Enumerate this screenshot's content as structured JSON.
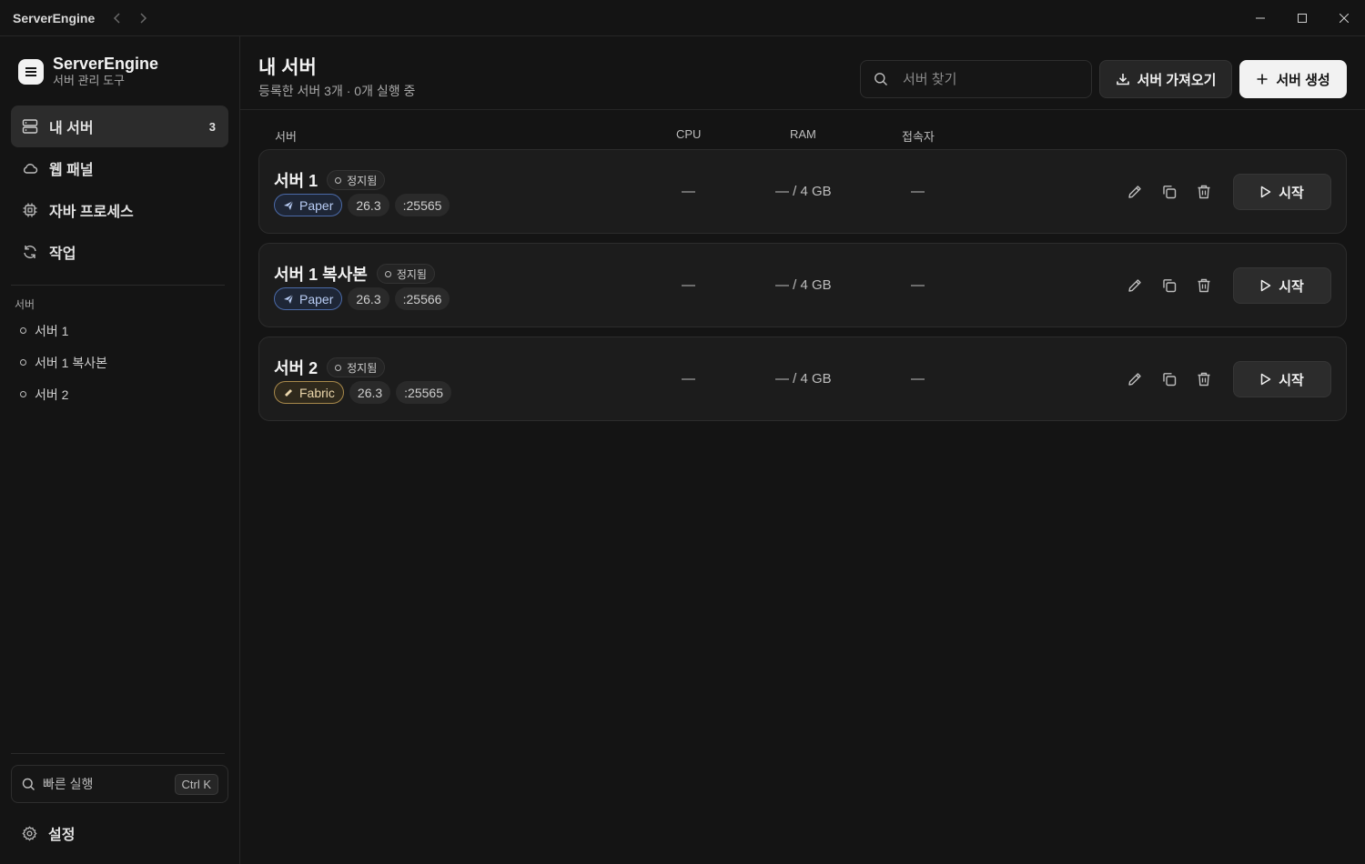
{
  "titlebar": {
    "app_name": "ServerEngine",
    "back_icon": "chevron-left-icon",
    "forward_icon": "chevron-right-icon",
    "window_controls": [
      "minimize-icon",
      "maximize-icon",
      "close-icon"
    ]
  },
  "sidebar": {
    "brand": {
      "title": "ServerEngine",
      "subtitle": "서버 관리 도구",
      "icon": "menu-icon"
    },
    "nav": [
      {
        "label": "내 서버",
        "badge": "3",
        "icon": "server-icon",
        "active": true
      },
      {
        "label": "웹 패널",
        "badge": "",
        "icon": "cloud-icon",
        "active": false
      },
      {
        "label": "자바 프로세스",
        "badge": "",
        "icon": "cpu-icon",
        "active": false
      },
      {
        "label": "작업",
        "badge": "",
        "icon": "refresh-icon",
        "active": false
      }
    ],
    "section_label": "서버",
    "servers": [
      "서버 1",
      "서버 1 복사본",
      "서버 2"
    ],
    "quick_run": {
      "label": "빠른 실행",
      "shortcut": "Ctrl K"
    },
    "settings_label": "설정"
  },
  "main": {
    "title": "내 서버",
    "subtitle": "등록한 서버 3개 · 0개 실행 중",
    "search_placeholder": "서버 찾기",
    "import_label": "서버 가져오기",
    "create_label": "서버 생성",
    "columns": {
      "server": "서버",
      "cpu": "CPU",
      "ram": "RAM",
      "players": "접속자"
    },
    "cards": [
      {
        "name": "서버 1",
        "status": "정지됨",
        "software": "Paper",
        "software_type": "paper",
        "version": "26.3",
        "port": ":25565",
        "cpu": "—",
        "ram": "— / 4 GB",
        "players": "—",
        "start_label": "시작"
      },
      {
        "name": "서버 1 복사본",
        "status": "정지됨",
        "software": "Paper",
        "software_type": "paper",
        "version": "26.3",
        "port": ":25566",
        "cpu": "—",
        "ram": "— / 4 GB",
        "players": "—",
        "start_label": "시작"
      },
      {
        "name": "서버 2",
        "status": "정지됨",
        "software": "Fabric",
        "software_type": "fabric",
        "version": "26.3",
        "port": ":25565",
        "cpu": "—",
        "ram": "— / 4 GB",
        "players": "—",
        "start_label": "시작"
      }
    ]
  }
}
